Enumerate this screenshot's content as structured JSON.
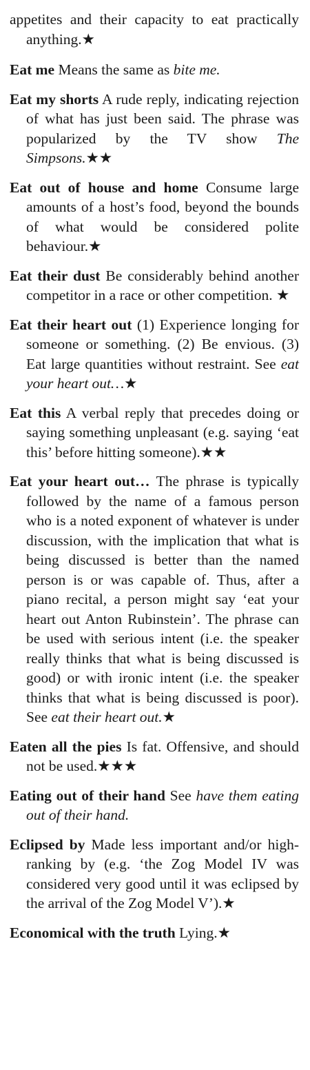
{
  "entries": [
    {
      "continuation": true,
      "headword": "",
      "parts": [
        {
          "text": "appetites and their capacity to eat practically anything.★",
          "italic": false
        }
      ]
    },
    {
      "headword": "Eat me",
      "parts": [
        {
          "text": " Means the same as ",
          "italic": false
        },
        {
          "text": "bite me.",
          "italic": true
        }
      ]
    },
    {
      "headword": "Eat my shorts",
      "parts": [
        {
          "text": " A rude reply, indicating rejection of what has just been said. The phrase was popularized by the TV show ",
          "italic": false
        },
        {
          "text": "The Simpsons.",
          "italic": true
        },
        {
          "text": "★★",
          "italic": false
        }
      ]
    },
    {
      "headword": "Eat out of house and home",
      "parts": [
        {
          "text": " Consume large amounts of a host’s food, beyond the bounds of what would be considered polite behaviour.★",
          "italic": false
        }
      ]
    },
    {
      "headword": "Eat their dust",
      "parts": [
        {
          "text": " Be considerably behind another competitor in a race or other competition. ★",
          "italic": false
        }
      ]
    },
    {
      "headword": "Eat their heart out",
      "parts": [
        {
          "text": " (1) Experience longing for someone or something. (2) Be envious. (3) Eat large quantities without restraint. See ",
          "italic": false
        },
        {
          "text": "eat your heart out…",
          "italic": true
        },
        {
          "text": "★",
          "italic": false
        }
      ]
    },
    {
      "headword": "Eat this",
      "parts": [
        {
          "text": " A verbal reply that precedes doing or saying something unpleasant (e.g. saying ‘eat this’ before hitting someone).★★",
          "italic": false
        }
      ]
    },
    {
      "headword": "Eat your heart out…",
      "parts": [
        {
          "text": " The phrase is typically followed by the name of a famous person who is a noted exponent of whatever is under discussion, with the implication that what is being discussed is better than the named person is or was capable of. Thus, after a piano recital, a person might say ‘eat your heart out Anton Rubinstein’. The phrase can be used with serious intent (i.e. the speaker really thinks that what is being discussed is good) or with ironic intent (i.e. the speaker thinks that what is being discussed is poor). See ",
          "italic": false
        },
        {
          "text": "eat their heart out.",
          "italic": true
        },
        {
          "text": "★",
          "italic": false
        }
      ]
    },
    {
      "headword": "Eaten all the pies",
      "parts": [
        {
          "text": " Is fat. Offensive, and should not be used.★★★",
          "italic": false
        }
      ]
    },
    {
      "headword": "Eating out of their hand",
      "parts": [
        {
          "text": " See ",
          "italic": false
        },
        {
          "text": "have them eating out of their hand.",
          "italic": true
        }
      ]
    },
    {
      "headword": "Eclipsed by",
      "parts": [
        {
          "text": " Made less important and/or high-ranking by (e.g. ‘the Zog Model IV was considered very good until it was eclipsed by the arrival of the Zog Model V’).★",
          "italic": false
        }
      ]
    },
    {
      "headword": "Economical with the truth",
      "parts": [
        {
          "text": " Lying.★",
          "italic": false
        }
      ]
    }
  ]
}
